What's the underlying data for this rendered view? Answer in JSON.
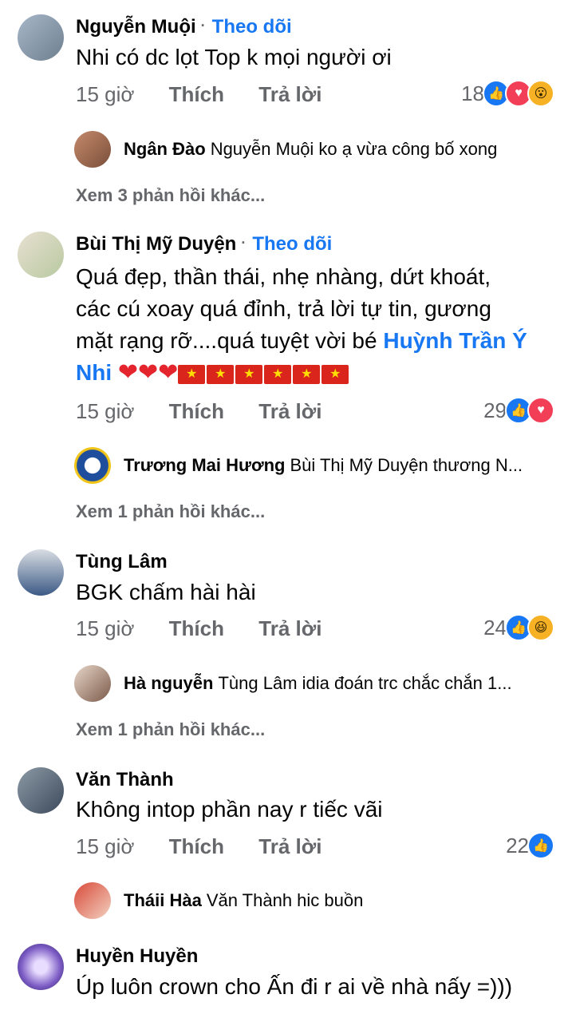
{
  "comments": [
    {
      "name": "Nguyễn Muội",
      "follow": "Theo dõi",
      "text": "Nhi có dc lọt Top k mọi người ơi",
      "time": "15 giờ",
      "like": "Thích",
      "reply": "Trả lời",
      "count": "18",
      "reactions": [
        "like-icon",
        "love-icon",
        "wow-icon"
      ],
      "replies": [
        {
          "name": "Ngân Đào",
          "text": "Nguyễn Muội ko ạ vừa công bố xong"
        }
      ],
      "more": "Xem 3 phản hồi khác..."
    },
    {
      "name": "Bùi Thị Mỹ Duyện",
      "follow": "Theo dõi",
      "text_line1": "Quá đẹp, thần thái, nhẹ nhàng, dứt khoát,",
      "text_line2": "các cú xoay quá đỉnh, trả lời tự tin, gương",
      "text_line3": "mặt rạng rỡ....quá tuyệt vời bé",
      "mention": "Huỳnh Trần Ý Nhi",
      "time": "15 giờ",
      "like": "Thích",
      "reply": "Trả lời",
      "count": "29",
      "reactions": [
        "like-icon",
        "love-icon"
      ],
      "replies": [
        {
          "name": "Trương Mai Hương",
          "text": "Bùi Thị Mỹ Duyện thương N..."
        }
      ],
      "more": "Xem 1 phản hồi khác..."
    },
    {
      "name": "Tùng Lâm",
      "text": "BGK chấm hài hài",
      "time": "15 giờ",
      "like": "Thích",
      "reply": "Trả lời",
      "count": "24",
      "reactions": [
        "like-icon",
        "haha-icon"
      ],
      "replies": [
        {
          "name": "Hà nguyễn",
          "text": "Tùng Lâm idia đoán trc chắc chắn 1..."
        }
      ],
      "more": "Xem 1 phản hồi khác..."
    },
    {
      "name": "Văn Thành",
      "text": "Không intop phần nay r tiếc vãi",
      "time": "15 giờ",
      "like": "Thích",
      "reply": "Trả lời",
      "count": "22",
      "reactions": [
        "like-icon"
      ],
      "replies": [
        {
          "name": "Tháii Hàa",
          "text": "Văn Thành hic buồn"
        }
      ]
    },
    {
      "name": "Huyền Huyền",
      "text": "Úp luôn crown cho Ấn đi r ai về nhà nấy =)))"
    }
  ]
}
